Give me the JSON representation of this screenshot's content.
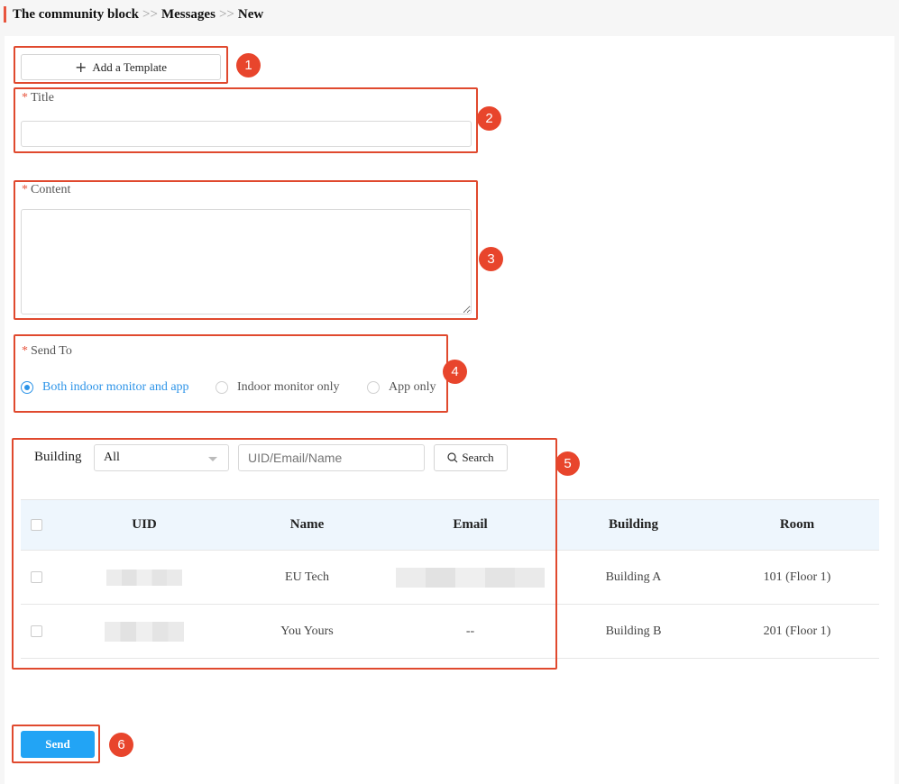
{
  "breadcrumb": {
    "part1": "The community block",
    "sep1": ">>",
    "part2": "Messages",
    "sep2": ">>",
    "part3": "New"
  },
  "template_button": {
    "label": "Add a Template"
  },
  "title_field": {
    "label": "Title",
    "required_mark": "*",
    "value": ""
  },
  "content_field": {
    "label": "Content",
    "required_mark": "*",
    "value": ""
  },
  "send_to": {
    "label": "Send To",
    "required_mark": "*",
    "options": [
      "Both indoor monitor and app",
      "Indoor monitor only",
      "App only"
    ],
    "selected": "Both indoor monitor and app"
  },
  "filter": {
    "building_label": "Building",
    "building_value": "All",
    "search_placeholder": "UID/Email/Name",
    "search_button": "Search"
  },
  "table": {
    "columns": [
      "UID",
      "Name",
      "Email",
      "Building",
      "Room"
    ],
    "rows": [
      {
        "uid": "",
        "name": "EU Tech",
        "email": "",
        "building": "Building A",
        "room": "101 (Floor 1)"
      },
      {
        "uid": "",
        "name": "You Yours",
        "email": "--",
        "building": "Building B",
        "room": "201 (Floor 1)"
      }
    ]
  },
  "send_button": {
    "label": "Send"
  },
  "annotations": [
    "1",
    "2",
    "3",
    "4",
    "5",
    "6"
  ],
  "colors": {
    "accent": "#2d94e8",
    "primary_button": "#22a4f5",
    "annotation": "#e8452c",
    "required": "#e8553e"
  }
}
